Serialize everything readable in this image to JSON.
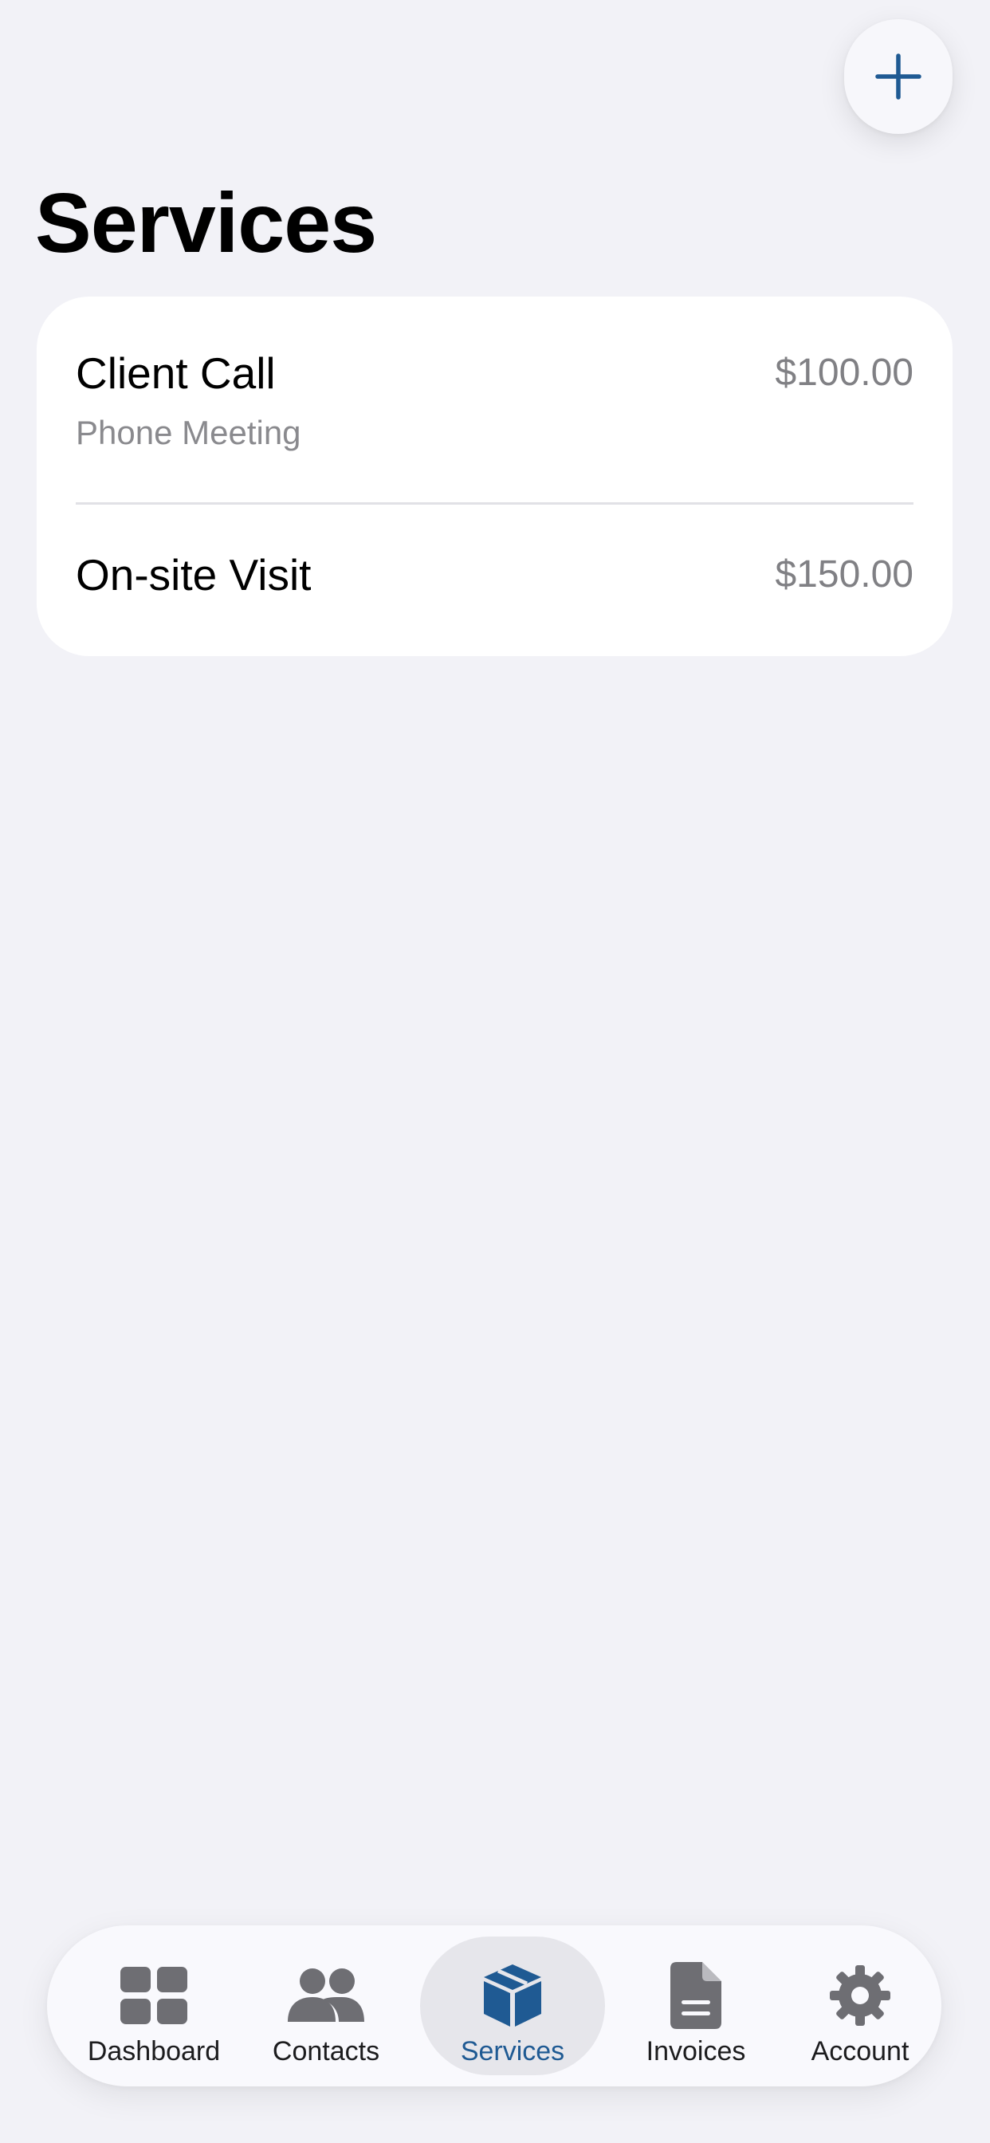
{
  "header": {
    "title": "Services",
    "add_button_icon": "plus-icon"
  },
  "services": [
    {
      "title": "Client Call",
      "subtitle": "Phone Meeting",
      "price": "$100.00"
    },
    {
      "title": "On-site Visit",
      "subtitle": "",
      "price": "$150.00"
    }
  ],
  "tabbar": {
    "active": "Services",
    "tabs": [
      {
        "label": "Dashboard",
        "icon": "grid-icon"
      },
      {
        "label": "Contacts",
        "icon": "people-icon"
      },
      {
        "label": "Services",
        "icon": "box-icon"
      },
      {
        "label": "Invoices",
        "icon": "document-icon"
      },
      {
        "label": "Account",
        "icon": "gear-icon"
      }
    ]
  },
  "colors": {
    "background": "#f2f2f7",
    "accent": "#1f5a93",
    "icon_inactive": "#6e6e73",
    "secondary_text": "#8a8a8e"
  }
}
